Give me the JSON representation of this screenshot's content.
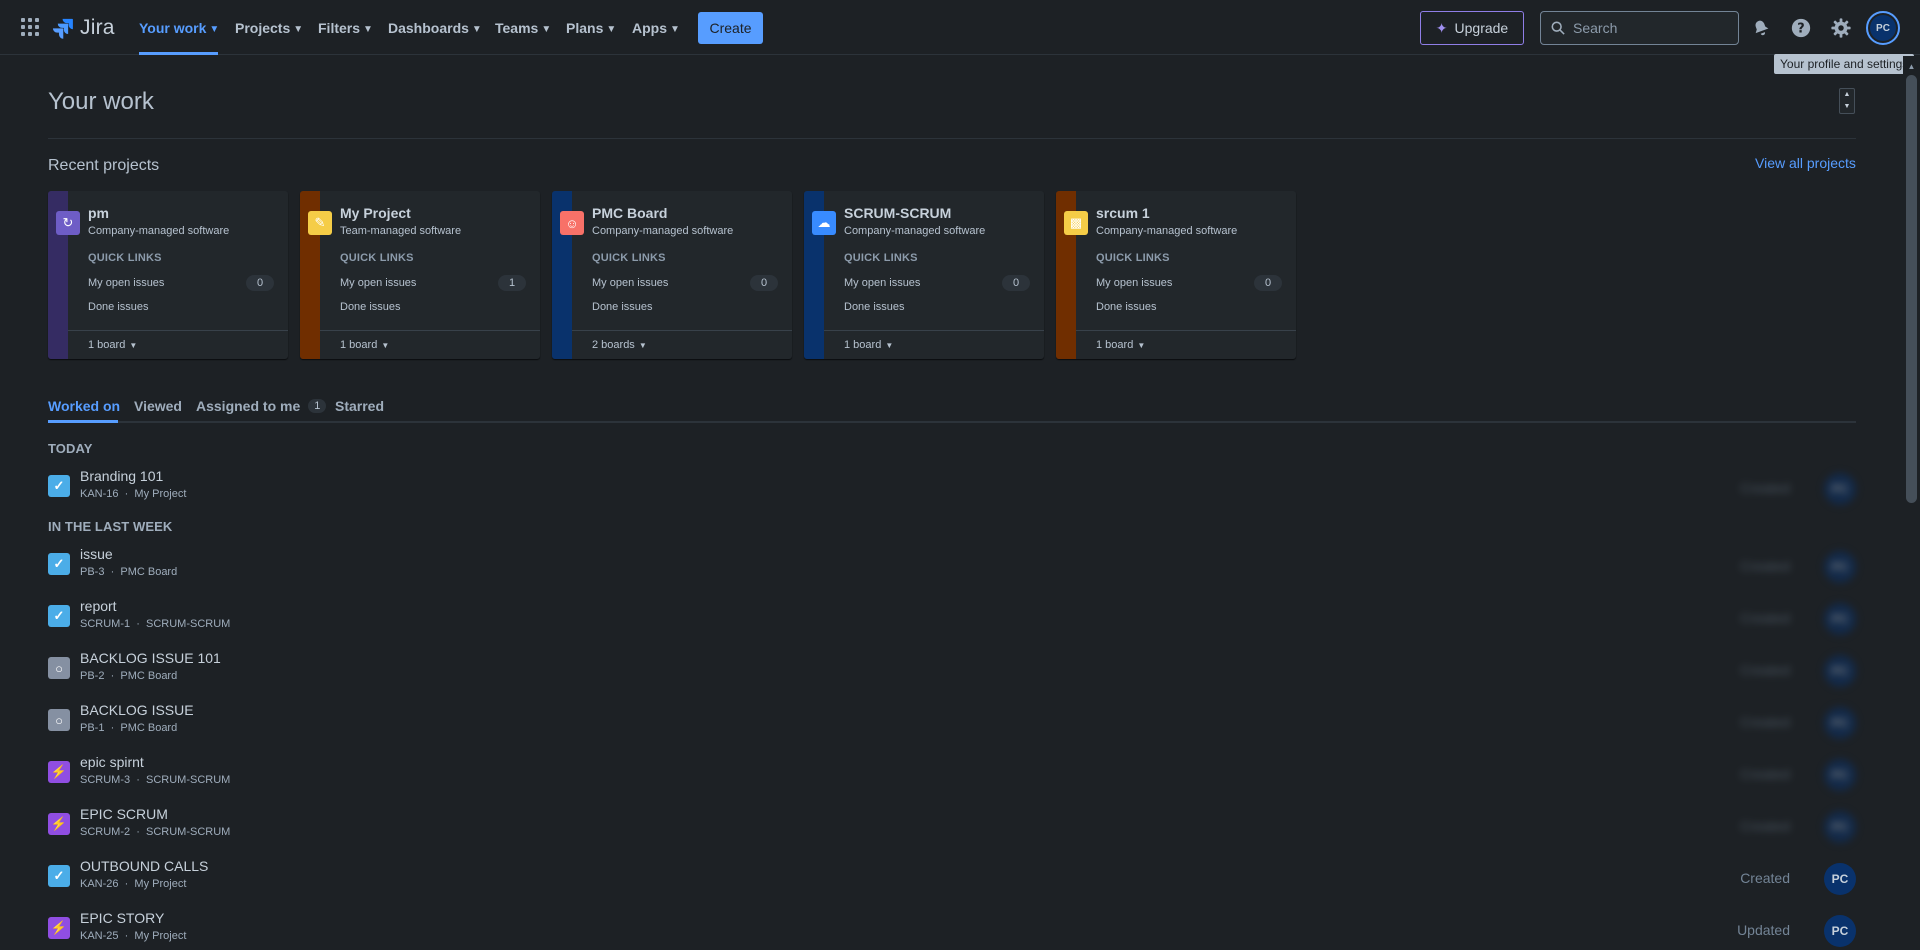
{
  "nav": {
    "logo_text": "Jira",
    "items": [
      {
        "label": "Your work",
        "active": true
      },
      {
        "label": "Projects"
      },
      {
        "label": "Filters"
      },
      {
        "label": "Dashboards"
      },
      {
        "label": "Teams"
      },
      {
        "label": "Plans"
      },
      {
        "label": "Apps"
      }
    ],
    "create_label": "Create",
    "upgrade_label": "Upgrade",
    "search_placeholder": "Search",
    "avatar_initials": "PC",
    "tooltip": "Your profile and settings",
    "icons": [
      "app-switcher-icon",
      "notifications-icon",
      "help-icon",
      "settings-icon"
    ]
  },
  "page": {
    "title": "Your work",
    "recent_title": "Recent projects",
    "view_all": "View all projects"
  },
  "projects": [
    {
      "name": "pm",
      "type": "Company-managed software",
      "quick_links": "QUICK LINKS",
      "open_label": "My open issues",
      "open_count": "0",
      "done_label": "Done issues",
      "boards": "1 board",
      "stripe": "#352c63",
      "icon_bg": "#6e5dc6",
      "icon": "pm-project-icon"
    },
    {
      "name": "My Project",
      "type": "Team-managed software",
      "quick_links": "QUICK LINKS",
      "open_label": "My open issues",
      "open_count": "1",
      "done_label": "Done issues",
      "boards": "1 board",
      "stripe": "#702e00",
      "icon_bg": "#f5cd47",
      "icon": "my-project-icon"
    },
    {
      "name": "PMC Board",
      "type": "Company-managed software",
      "quick_links": "QUICK LINKS",
      "open_label": "My open issues",
      "open_count": "0",
      "done_label": "Done issues",
      "boards": "2 boards",
      "stripe": "#09326c",
      "icon_bg": "#f87168",
      "icon": "pmc-board-icon"
    },
    {
      "name": "SCRUM-SCRUM",
      "type": "Company-managed software",
      "quick_links": "QUICK LINKS",
      "open_label": "My open issues",
      "open_count": "0",
      "done_label": "Done issues",
      "boards": "1 board",
      "stripe": "#09326c",
      "icon_bg": "#388bff",
      "icon": "scrum-project-icon"
    },
    {
      "name": "srcum 1",
      "type": "Company-managed software",
      "quick_links": "QUICK LINKS",
      "open_label": "My open issues",
      "open_count": "0",
      "done_label": "Done issues",
      "boards": "1 board",
      "stripe": "#702e00",
      "icon_bg": "#f5cd47",
      "icon": "srcum-project-icon"
    }
  ],
  "tabs": [
    {
      "label": "Worked on",
      "active": true
    },
    {
      "label": "Viewed"
    },
    {
      "label": "Assigned to me",
      "count": "1"
    },
    {
      "label": "Starred"
    }
  ],
  "groups": {
    "today": "TODAY",
    "last_week": "IN THE LAST WEEK"
  },
  "items": [
    {
      "title": "Branding 101",
      "key": "KAN-16",
      "project": "My Project",
      "type": "task",
      "action": "Created"
    },
    {
      "title": "issue",
      "key": "PB-3",
      "project": "PMC Board",
      "type": "task",
      "action": "Created"
    },
    {
      "title": "report",
      "key": "SCRUM-1",
      "project": "SCRUM-SCRUM",
      "type": "task",
      "action": "Created"
    },
    {
      "title": "BACKLOG ISSUE 101",
      "key": "PB-2",
      "project": "PMC Board",
      "type": "subtask",
      "action": "Created"
    },
    {
      "title": "BACKLOG ISSUE",
      "key": "PB-1",
      "project": "PMC Board",
      "type": "subtask",
      "action": "Created"
    },
    {
      "title": "epic spirnt",
      "key": "SCRUM-3",
      "project": "SCRUM-SCRUM",
      "type": "epic",
      "action": "Created"
    },
    {
      "title": "EPIC SCRUM",
      "key": "SCRUM-2",
      "project": "SCRUM-SCRUM",
      "type": "epic",
      "action": "Created"
    },
    {
      "title": "OUTBOUND CALLS",
      "key": "KAN-26",
      "project": "My Project",
      "type": "task",
      "action": "Created"
    },
    {
      "title": "EPIC STORY",
      "key": "KAN-25",
      "project": "My Project",
      "type": "epic",
      "action": "Updated"
    }
  ],
  "colors": {
    "accent": "#579dff",
    "task": "#4bade8",
    "epic": "#904ee2",
    "subtask": "#8590a2"
  }
}
